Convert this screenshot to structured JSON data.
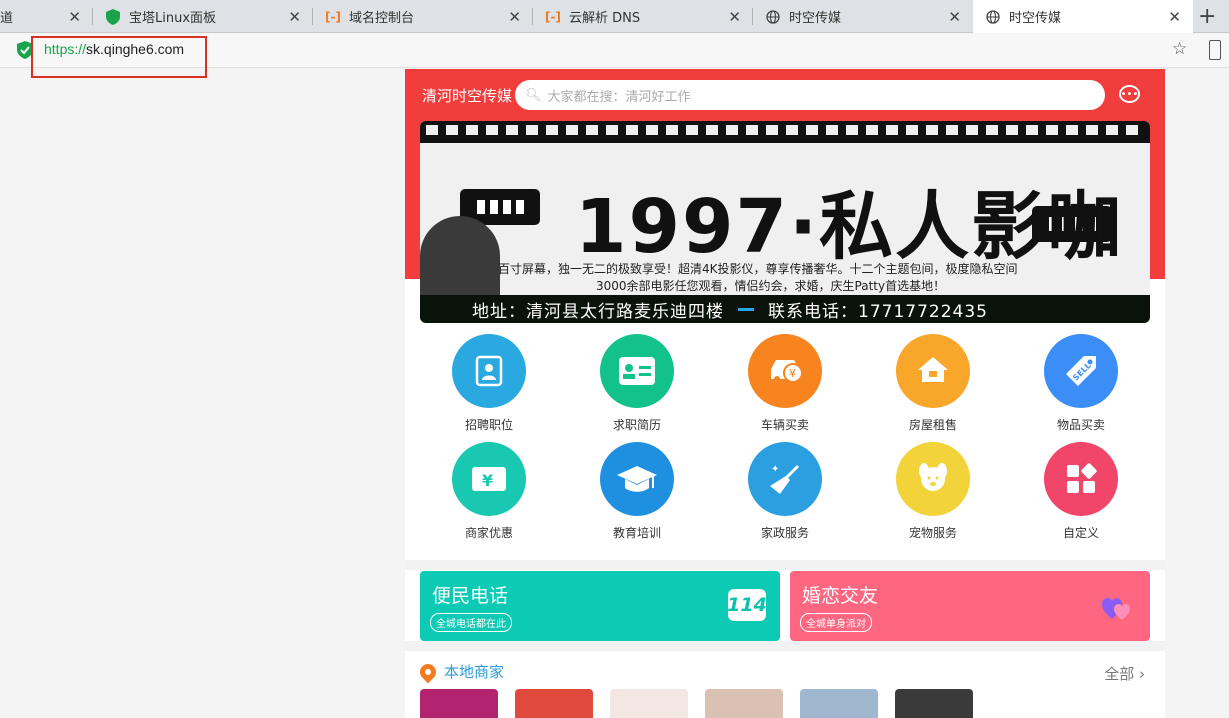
{
  "browser": {
    "tabs": [
      {
        "label": "道",
        "icon": "page-icon"
      },
      {
        "label": "宝塔Linux面板",
        "icon": "shield-icon"
      },
      {
        "label": "域名控制台",
        "icon": "aliyun-icon"
      },
      {
        "label": "云解析 DNS",
        "icon": "aliyun-icon"
      },
      {
        "label": "时空传媒",
        "icon": "globe-icon"
      },
      {
        "label": "时空传媒",
        "icon": "globe-icon"
      }
    ],
    "new_tab": "+",
    "close": "✕",
    "url_protocol": "https://",
    "url_host": "sk.qinghe6.com"
  },
  "site": {
    "brand": "清河时空传媒",
    "search_placeholder": "大家都在搜：清河好工作",
    "banner": {
      "title": "1997·私人影咖",
      "desc_line1": "百寸屏幕，独一无二的极致享受！超清4K投影仪，尊享传播奢华。十二个主题包间，极度隐私空间",
      "desc_line2": "3000余部电影任您观看，情侣约会，求婚，庆生Patty首选基地！",
      "address": "地址：清河县太行路麦乐迪四楼",
      "phone": "联系电话：17717722435"
    },
    "categories": [
      {
        "label": "招聘职位",
        "color": "#29a9e0",
        "glyph": "👤"
      },
      {
        "label": "求职简历",
        "color": "#12c28a",
        "glyph": "▤"
      },
      {
        "label": "车辆买卖",
        "color": "#f7841f",
        "glyph": "🚗"
      },
      {
        "label": "房屋租售",
        "color": "#f9a72b",
        "glyph": "⌂"
      },
      {
        "label": "物品买卖",
        "color": "#3b8ef5",
        "glyph": "🏷"
      },
      {
        "label": "商家优惠",
        "color": "#19c8b0",
        "glyph": "¥"
      },
      {
        "label": "教育培训",
        "color": "#1f8fe0",
        "glyph": "🎓"
      },
      {
        "label": "家政服务",
        "color": "#2c9fe0",
        "glyph": "🧹"
      },
      {
        "label": "宠物服务",
        "color": "#f2d43a",
        "glyph": "🐶"
      },
      {
        "label": "自定义",
        "color": "#f2456a",
        "glyph": "▦"
      }
    ],
    "cards": [
      {
        "title": "便民电话",
        "sub": "全城电话都在此",
        "badge": "114",
        "color": "#0ccab4"
      },
      {
        "title": "婚恋交友",
        "sub": "全城单身派对",
        "color": "#ff6680"
      }
    ],
    "merchants": {
      "title": "本地商家",
      "more": "全部 ›"
    }
  }
}
